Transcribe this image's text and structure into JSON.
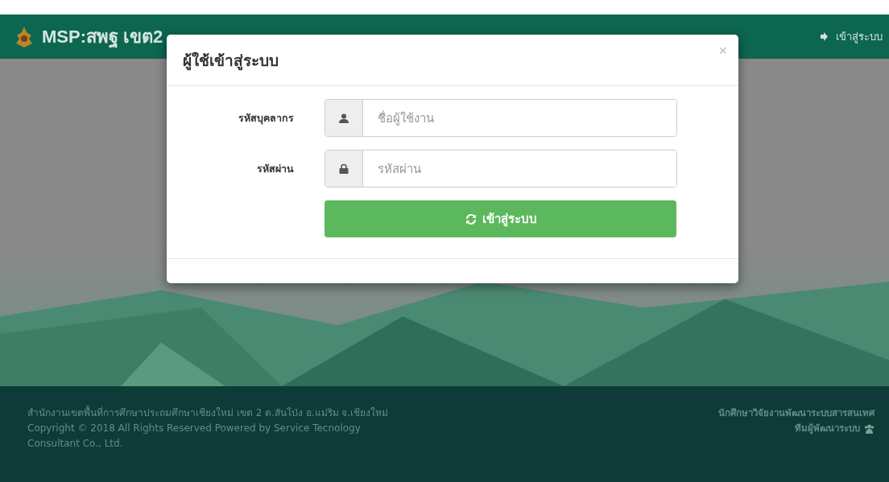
{
  "navbar": {
    "brand": "MSP:สพฐ เขต2",
    "login_link": "เข้าสู่ระบบ"
  },
  "login_modal": {
    "title": "ผู้ใช้เข้าสู่ระบบ",
    "close": "×",
    "fields": [
      {
        "kind": "user",
        "label": "รหัสบุคลากร",
        "placeholder": "ชื่อผู้ใช้งาน"
      },
      {
        "kind": "password",
        "label": "รหัสผ่าน",
        "placeholder": "รหัสผ่าน"
      }
    ],
    "submit": "เข้าสู่ระบบ"
  },
  "footer": {
    "left": [
      "สำนักงานเขตพื้นที่การศึกษาประถมศึกษาเชียงใหม่ เขต 2 ต.สันโป่ง อ.แม่ริม จ.เชียงใหม่",
      "Copyright © 2018 All Rights Reserved Powered by Service Tecnology Consultant Co., Ltd."
    ],
    "right": [
      "นักศึกษาวิจัยงานพัฒนาระบบสารสนเทศ",
      "ทีมผู้พัฒนาระบบ"
    ]
  }
}
